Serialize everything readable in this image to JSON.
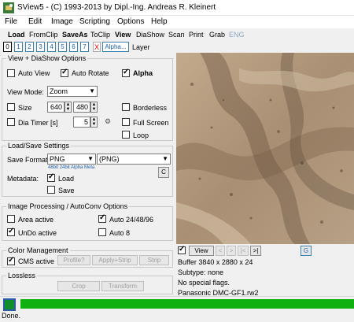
{
  "window": {
    "title": "SView5 - (C) 1993-2013 by Dipl.-Ing. Andreas R. Kleinert"
  },
  "menu": [
    "File",
    "Edit",
    "Image",
    "Scripting",
    "Options",
    "Help"
  ],
  "toolbar": {
    "load": "Load",
    "from_clip": "FromClip",
    "save_as": "SaveAs",
    "to_clip": "ToClip",
    "view": "View",
    "diashow": "DiaShow",
    "scan": "Scan",
    "print": "Print",
    "grab": "Grab",
    "eng": "ENG"
  },
  "slots": {
    "numbers": [
      "0",
      "1",
      "2",
      "3",
      "4",
      "5",
      "6",
      "7"
    ],
    "clear": "X",
    "alpha": "Alpha...",
    "layer_label": "Layer"
  },
  "view_diashow": {
    "title": "View + DiaShow Options",
    "auto_view": "Auto View",
    "auto_rotate": "Auto Rotate",
    "alpha": "Alpha",
    "view_mode_label": "View Mode:",
    "view_mode_value": "Zoom",
    "size_label": "Size",
    "width": "640",
    "height": "480",
    "borderless": "Borderless",
    "dia_timer_label": "Dia Timer [s]",
    "dia_timer_value": "5",
    "full_screen": "Full Screen",
    "loop": "Loop",
    "gear_icon": "gear"
  },
  "load_save": {
    "title": "Load/Save Settings",
    "save_format_label": "Save Format:",
    "save_format_value": "PNG",
    "save_format_ext": "(PNG)",
    "format_hint": "48bit 24bit Alpha Meta",
    "c_button": "C",
    "metadata_label": "Metadata:",
    "load": "Load",
    "save": "Save"
  },
  "processing": {
    "title": "Image Processing / AutoConv Options",
    "area_active": "Area active",
    "auto_24": "Auto 24/48/96",
    "undo_active": "UnDo active",
    "auto_8": "Auto 8"
  },
  "color_mgmt": {
    "title": "Color Management",
    "cms_active": "CMS active",
    "profile": "Profile?",
    "apply_strip": "Apply+Strip",
    "strip": "Strip"
  },
  "lossless": {
    "title": "Lossless",
    "crop": "Crop",
    "transform": "Transform"
  },
  "preview_nav": {
    "view": "View",
    "prev": "<",
    "next": ">",
    "skip": "|<",
    "end": ">|",
    "g": "G"
  },
  "info": {
    "buffer": "Buffer 3840 x 2880 x 24",
    "subtype": "Subtype: none",
    "flags": "No special flags.",
    "file": "Panasonic DMC-GF1.rw2"
  },
  "status": {
    "text": "Done.",
    "progress": 1.0
  },
  "colors": {
    "accent": "#1f5fb0",
    "progress": "#10b010"
  }
}
